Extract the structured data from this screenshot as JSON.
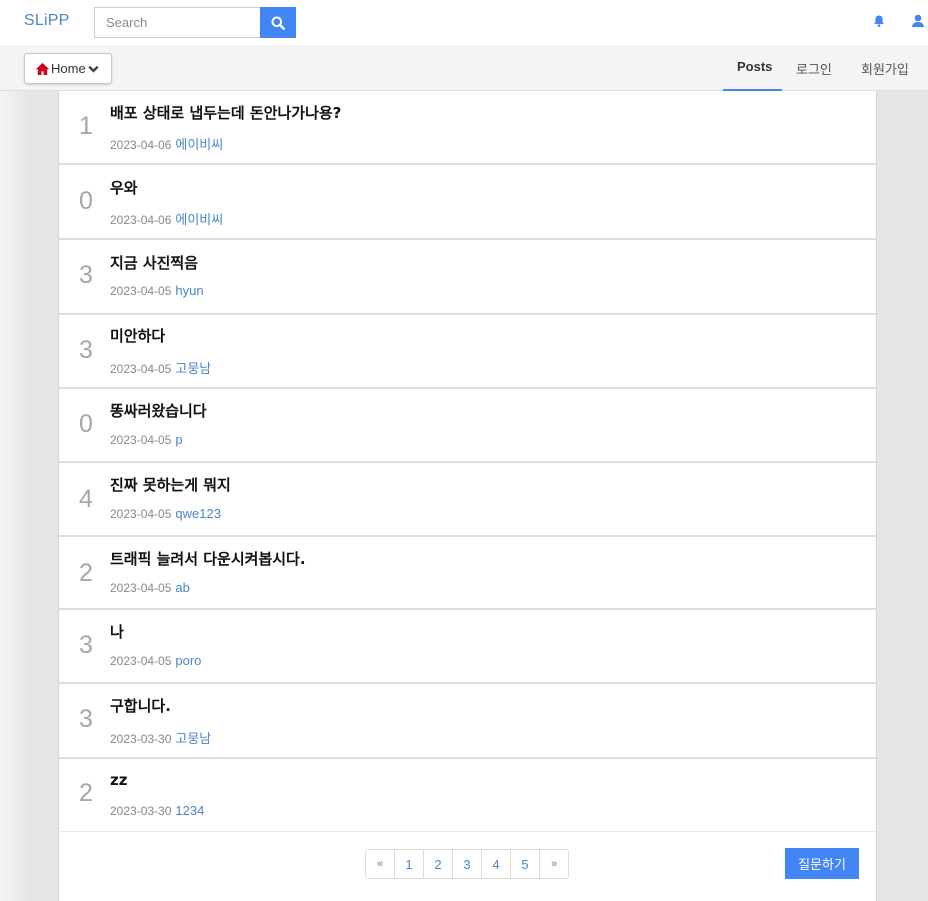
{
  "brand": "SLiPP",
  "search": {
    "placeholder": "Search",
    "value": ""
  },
  "icons": {
    "search": "search-icon",
    "bell": "bell-icon",
    "user": "user-icon",
    "home": "home-icon",
    "chevron": "chevron-down-icon"
  },
  "colors": {
    "accent": "#4285f4",
    "link": "#4a86c7",
    "home_icon": "#d0021b"
  },
  "subnav": {
    "home_label": "Home",
    "posts_label": "Posts",
    "login_label": "로그인",
    "signup_label": "회원가입"
  },
  "posts": [
    {
      "count": "1",
      "title": "배포 상태로 냅두는데 돈안나가나용?",
      "date": "2023-04-06",
      "author": "에이비씨"
    },
    {
      "count": "0",
      "title": "우와",
      "date": "2023-04-06",
      "author": "에이비씨"
    },
    {
      "count": "3",
      "title": "지금 사진찍음",
      "date": "2023-04-05",
      "author": "hyun"
    },
    {
      "count": "3",
      "title": "미안하다",
      "date": "2023-04-05",
      "author": "고뭉남"
    },
    {
      "count": "0",
      "title": "똥싸러왔습니다",
      "date": "2023-04-05",
      "author": "p"
    },
    {
      "count": "4",
      "title": "진짜 못하는게 뭐지",
      "date": "2023-04-05",
      "author": "qwe123"
    },
    {
      "count": "2",
      "title": "트래픽 늘려서 다운시켜봅시다.",
      "date": "2023-04-05",
      "author": "ab"
    },
    {
      "count": "3",
      "title": "나",
      "date": "2023-04-05",
      "author": "poro"
    },
    {
      "count": "3",
      "title": "구합니다.",
      "date": "2023-03-30",
      "author": "고뭉남"
    },
    {
      "count": "2",
      "title": "zz",
      "date": "2023-03-30",
      "author": "1234"
    }
  ],
  "pagination": {
    "prev": "«",
    "pages": [
      "1",
      "2",
      "3",
      "4",
      "5"
    ],
    "next": "»"
  },
  "ask_button": "질문하기"
}
